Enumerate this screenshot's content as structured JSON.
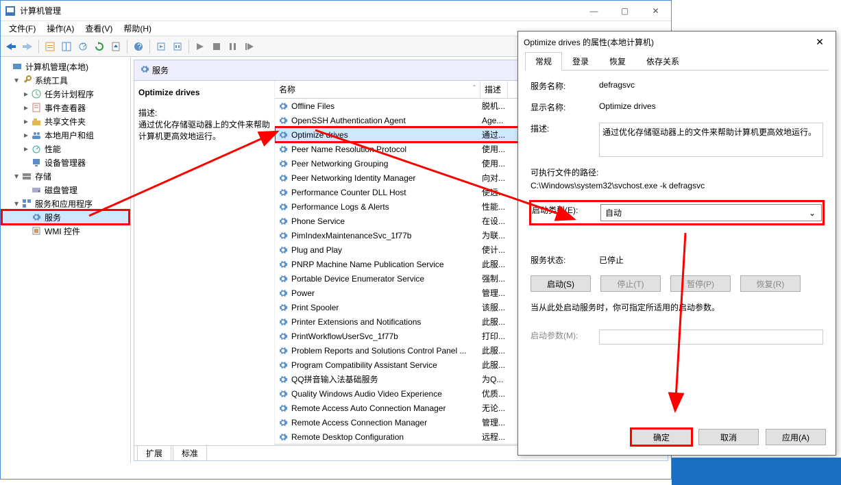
{
  "window": {
    "title": "计算机管理",
    "menu": [
      "文件(F)",
      "操作(A)",
      "查看(V)",
      "帮助(H)"
    ]
  },
  "tree": {
    "root": "计算机管理(本地)",
    "items": [
      {
        "indent": 1,
        "twisty": "▾",
        "icon": "wrench",
        "label": "系统工具"
      },
      {
        "indent": 2,
        "twisty": "▸",
        "icon": "clock",
        "label": "任务计划程序"
      },
      {
        "indent": 2,
        "twisty": "▸",
        "icon": "log",
        "label": "事件查看器"
      },
      {
        "indent": 2,
        "twisty": "▸",
        "icon": "share",
        "label": "共享文件夹"
      },
      {
        "indent": 2,
        "twisty": "▸",
        "icon": "users",
        "label": "本地用户和组"
      },
      {
        "indent": 2,
        "twisty": "▸",
        "icon": "perf",
        "label": "性能"
      },
      {
        "indent": 2,
        "twisty": "",
        "icon": "device",
        "label": "设备管理器"
      },
      {
        "indent": 1,
        "twisty": "▾",
        "icon": "storage",
        "label": "存储"
      },
      {
        "indent": 2,
        "twisty": "",
        "icon": "disk",
        "label": "磁盘管理"
      },
      {
        "indent": 1,
        "twisty": "▾",
        "icon": "apps",
        "label": "服务和应用程序"
      },
      {
        "indent": 2,
        "twisty": "",
        "icon": "gear",
        "label": "服务",
        "sel": true,
        "hl": true
      },
      {
        "indent": 2,
        "twisty": "",
        "icon": "wmi",
        "label": "WMI 控件"
      }
    ]
  },
  "detail": {
    "header": "服务",
    "selected_title": "Optimize drives",
    "desc_label": "描述:",
    "desc_text": "通过优化存储驱动器上的文件来帮助计算机更高效地运行。",
    "col_name": "名称",
    "col_desc": "描述",
    "tabs": [
      "扩展",
      "标准"
    ],
    "rows": [
      {
        "name": "Offline Files",
        "desc": "脱机..."
      },
      {
        "name": "OpenSSH Authentication Agent",
        "desc": "Age..."
      },
      {
        "name": "Optimize drives",
        "desc": "通过...",
        "sel": true,
        "hl": true
      },
      {
        "name": "Peer Name Resolution Protocol",
        "desc": "使用..."
      },
      {
        "name": "Peer Networking Grouping",
        "desc": "使用..."
      },
      {
        "name": "Peer Networking Identity Manager",
        "desc": "向对..."
      },
      {
        "name": "Performance Counter DLL Host",
        "desc": "使远..."
      },
      {
        "name": "Performance Logs & Alerts",
        "desc": "性能..."
      },
      {
        "name": "Phone Service",
        "desc": "在设..."
      },
      {
        "name": "PimIndexMaintenanceSvc_1f77b",
        "desc": "为联..."
      },
      {
        "name": "Plug and Play",
        "desc": "使计..."
      },
      {
        "name": "PNRP Machine Name Publication Service",
        "desc": "此服..."
      },
      {
        "name": "Portable Device Enumerator Service",
        "desc": "强制..."
      },
      {
        "name": "Power",
        "desc": "管理..."
      },
      {
        "name": "Print Spooler",
        "desc": "该服..."
      },
      {
        "name": "Printer Extensions and Notifications",
        "desc": "此服..."
      },
      {
        "name": "PrintWorkflowUserSvc_1f77b",
        "desc": "打印..."
      },
      {
        "name": "Problem Reports and Solutions Control Panel ...",
        "desc": "此服..."
      },
      {
        "name": "Program Compatibility Assistant Service",
        "desc": "此服..."
      },
      {
        "name": "QQ拼音输入法基础服务",
        "desc": "为Q..."
      },
      {
        "name": "Quality Windows Audio Video Experience",
        "desc": "优质..."
      },
      {
        "name": "Remote Access Auto Connection Manager",
        "desc": "无论..."
      },
      {
        "name": "Remote Access Connection Manager",
        "desc": "管理..."
      },
      {
        "name": "Remote Desktop Configuration",
        "desc": "远程..."
      }
    ]
  },
  "dialog": {
    "title": "Optimize drives 的属性(本地计算机)",
    "tabs": [
      "常规",
      "登录",
      "恢复",
      "依存关系"
    ],
    "service_name_lbl": "服务名称:",
    "service_name": "defragsvc",
    "display_name_lbl": "显示名称:",
    "display_name": "Optimize drives",
    "desc_lbl": "描述:",
    "desc": "通过优化存储驱动器上的文件来帮助计算机更高效地运行。",
    "exe_lbl": "可执行文件的路径:",
    "exe": "C:\\Windows\\system32\\svchost.exe -k defragsvc",
    "startup_lbl": "启动类型(E):",
    "startup_val": "自动",
    "status_lbl": "服务状态:",
    "status": "已停止",
    "btn_start": "启动(S)",
    "btn_stop": "停止(T)",
    "btn_pause": "暂停(P)",
    "btn_resume": "恢复(R)",
    "hint": "当从此处启动服务时，你可指定所适用的启动参数。",
    "param_lbl": "启动参数(M):",
    "ok": "确定",
    "cancel": "取消",
    "apply": "应用(A)"
  }
}
